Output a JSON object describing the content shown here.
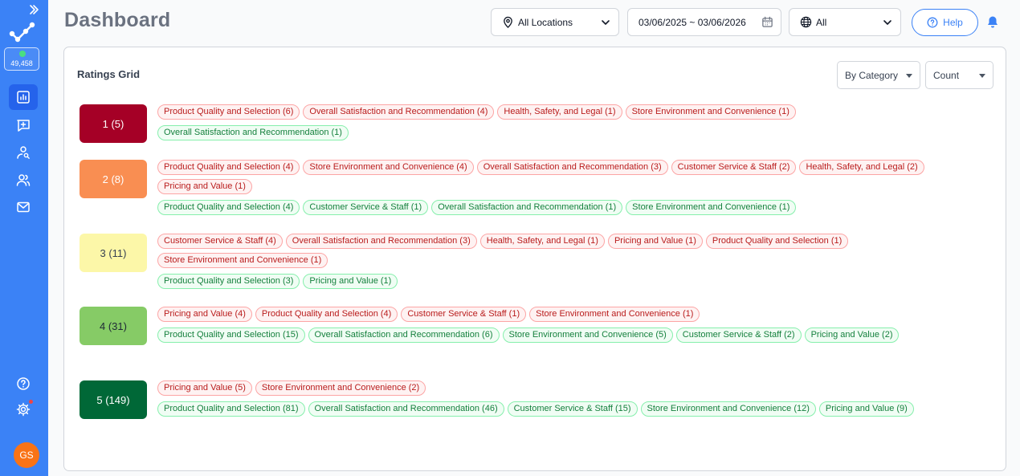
{
  "sidebar": {
    "counter": "49,458",
    "avatar_initials": "GS",
    "accent": "#3b82f6",
    "icons": [
      "chevrons-right-icon",
      "logo-icon",
      "bar-chart-icon",
      "add-message-icon",
      "user-search-icon",
      "users-icon",
      "mail-icon",
      "help-circle-icon",
      "gear-icon"
    ]
  },
  "header": {
    "title": "Dashboard",
    "location": "All Locations",
    "date_range": "03/06/2025 ~ 03/06/2026",
    "language": "All",
    "help_label": "Help"
  },
  "card": {
    "title": "Ratings Grid",
    "group_by": "By Category",
    "metric": "Count"
  },
  "ratings": [
    {
      "label": "1 (5)",
      "bg": "#a50026",
      "fg": "#ffffff",
      "negative": [
        "Product Quality and Selection (6)",
        "Overall Satisfaction and Recommendation (4)",
        "Health, Safety, and Legal (1)",
        "Store Environment and Convenience (1)"
      ],
      "positive": [
        "Overall Satisfaction and Recommendation (1)"
      ]
    },
    {
      "label": "2 (8)",
      "bg": "#f98e52",
      "fg": "#ffffff",
      "negative": [
        "Product Quality and Selection (4)",
        "Store Environment and Convenience (4)",
        "Overall Satisfaction and Recommendation (3)",
        "Customer Service & Staff (2)",
        "Health, Safety, and Legal (2)",
        "Pricing and Value (1)"
      ],
      "positive": [
        "Product Quality and Selection (4)",
        "Customer Service & Staff (1)",
        "Overall Satisfaction and Recommendation (1)",
        "Store Environment and Convenience (1)"
      ]
    },
    {
      "label": "3 (11)",
      "bg": "#fcf7a8",
      "fg": "#374151",
      "negative": [
        "Customer Service & Staff (4)",
        "Overall Satisfaction and Recommendation (3)",
        "Health, Safety, and Legal (1)",
        "Pricing and Value (1)",
        "Product Quality and Selection (1)",
        "Store Environment and Convenience (1)"
      ],
      "positive": [
        "Product Quality and Selection (3)",
        "Pricing and Value (1)"
      ]
    },
    {
      "label": "4 (31)",
      "bg": "#86cb66",
      "fg": "#1f2937",
      "negative": [
        "Pricing and Value (4)",
        "Product Quality and Selection (4)",
        "Customer Service & Staff (1)",
        "Store Environment and Convenience (1)"
      ],
      "positive": [
        "Product Quality and Selection (15)",
        "Overall Satisfaction and Recommendation (6)",
        "Store Environment and Convenience (5)",
        "Customer Service & Staff (2)",
        "Pricing and Value (2)"
      ]
    },
    {
      "label": "5 (149)",
      "bg": "#006837",
      "fg": "#ffffff",
      "negative": [
        "Pricing and Value (5)",
        "Store Environment and Convenience (2)"
      ],
      "positive": [
        "Product Quality and Selection (81)",
        "Overall Satisfaction and Recommendation (46)",
        "Customer Service & Staff (15)",
        "Store Environment and Convenience (12)",
        "Pricing and Value (9)"
      ]
    }
  ]
}
